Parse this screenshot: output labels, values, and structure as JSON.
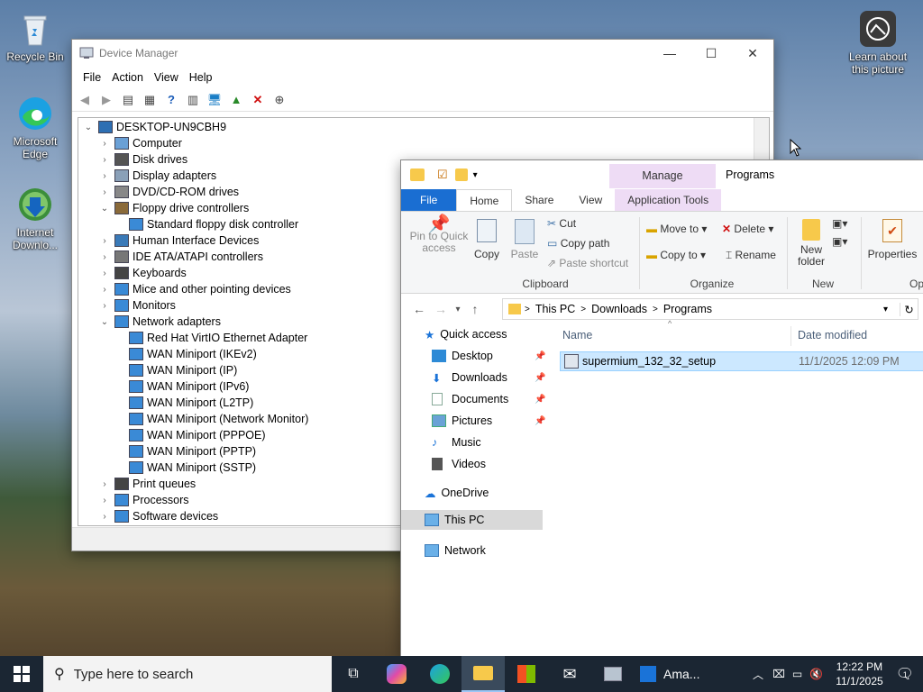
{
  "desktop": {
    "icons": [
      {
        "label": "Recycle Bin"
      },
      {
        "label": "Microsoft Edge"
      },
      {
        "label": "Internet Downlo..."
      },
      {
        "label": "Learn about this picture"
      }
    ]
  },
  "device_manager": {
    "title": "Device Manager",
    "menu": [
      "File",
      "Action",
      "View",
      "Help"
    ],
    "tree": [
      {
        "label": "DESKTOP-UN9CBH9",
        "level": 0,
        "expanded": true
      },
      {
        "label": "Computer",
        "level": 1,
        "expanded": false
      },
      {
        "label": "Disk drives",
        "level": 1,
        "expanded": false
      },
      {
        "label": "Display adapters",
        "level": 1,
        "expanded": false
      },
      {
        "label": "DVD/CD-ROM drives",
        "level": 1,
        "expanded": false
      },
      {
        "label": "Floppy drive controllers",
        "level": 1,
        "expanded": true
      },
      {
        "label": "Standard floppy disk controller",
        "level": 2
      },
      {
        "label": "Human Interface Devices",
        "level": 1,
        "expanded": false
      },
      {
        "label": "IDE ATA/ATAPI controllers",
        "level": 1,
        "expanded": false
      },
      {
        "label": "Keyboards",
        "level": 1,
        "expanded": false
      },
      {
        "label": "Mice and other pointing devices",
        "level": 1,
        "expanded": false
      },
      {
        "label": "Monitors",
        "level": 1,
        "expanded": false
      },
      {
        "label": "Network adapters",
        "level": 1,
        "expanded": true
      },
      {
        "label": "Red Hat VirtIO Ethernet Adapter",
        "level": 2
      },
      {
        "label": "WAN Miniport (IKEv2)",
        "level": 2
      },
      {
        "label": "WAN Miniport (IP)",
        "level": 2
      },
      {
        "label": "WAN Miniport (IPv6)",
        "level": 2
      },
      {
        "label": "WAN Miniport (L2TP)",
        "level": 2
      },
      {
        "label": "WAN Miniport (Network Monitor)",
        "level": 2
      },
      {
        "label": "WAN Miniport (PPPOE)",
        "level": 2
      },
      {
        "label": "WAN Miniport (PPTP)",
        "level": 2
      },
      {
        "label": "WAN Miniport (SSTP)",
        "level": 2
      },
      {
        "label": "Print queues",
        "level": 1,
        "expanded": false
      },
      {
        "label": "Processors",
        "level": 1,
        "expanded": false
      },
      {
        "label": "Software devices",
        "level": 1,
        "expanded": false
      }
    ]
  },
  "explorer": {
    "context_tab": "Manage",
    "window_title": "Programs",
    "tabs": [
      "File",
      "Home",
      "Share",
      "View",
      "Application Tools"
    ],
    "ribbon": {
      "pin": "Pin to Quick access",
      "copy": "Copy",
      "paste": "Paste",
      "cut": "Cut",
      "copy_path": "Copy path",
      "paste_shortcut": "Paste shortcut",
      "group_clipboard": "Clipboard",
      "move_to": "Move to",
      "copy_to": "Copy to",
      "delete": "Delete",
      "rename": "Rename",
      "group_organize": "Organize",
      "new_folder": "New folder",
      "group_new": "New",
      "properties": "Properties",
      "group_open": "Op"
    },
    "breadcrumb": [
      "This PC",
      "Downloads",
      "Programs"
    ],
    "nav": {
      "quick_access": "Quick access",
      "desktop": "Desktop",
      "downloads": "Downloads",
      "documents": "Documents",
      "pictures": "Pictures",
      "music": "Music",
      "videos": "Videos",
      "onedrive": "OneDrive",
      "this_pc": "This PC",
      "network": "Network"
    },
    "columns": {
      "name": "Name",
      "date_modified": "Date modified"
    },
    "files": [
      {
        "name": "supermium_132_32_setup",
        "date": "11/1/2025 12:09 PM"
      }
    ]
  },
  "taskbar": {
    "search_placeholder": "Type here to search",
    "amazon_label": "Ama...",
    "time": "12:22 PM",
    "date": "11/1/2025",
    "notification_count": "1"
  }
}
